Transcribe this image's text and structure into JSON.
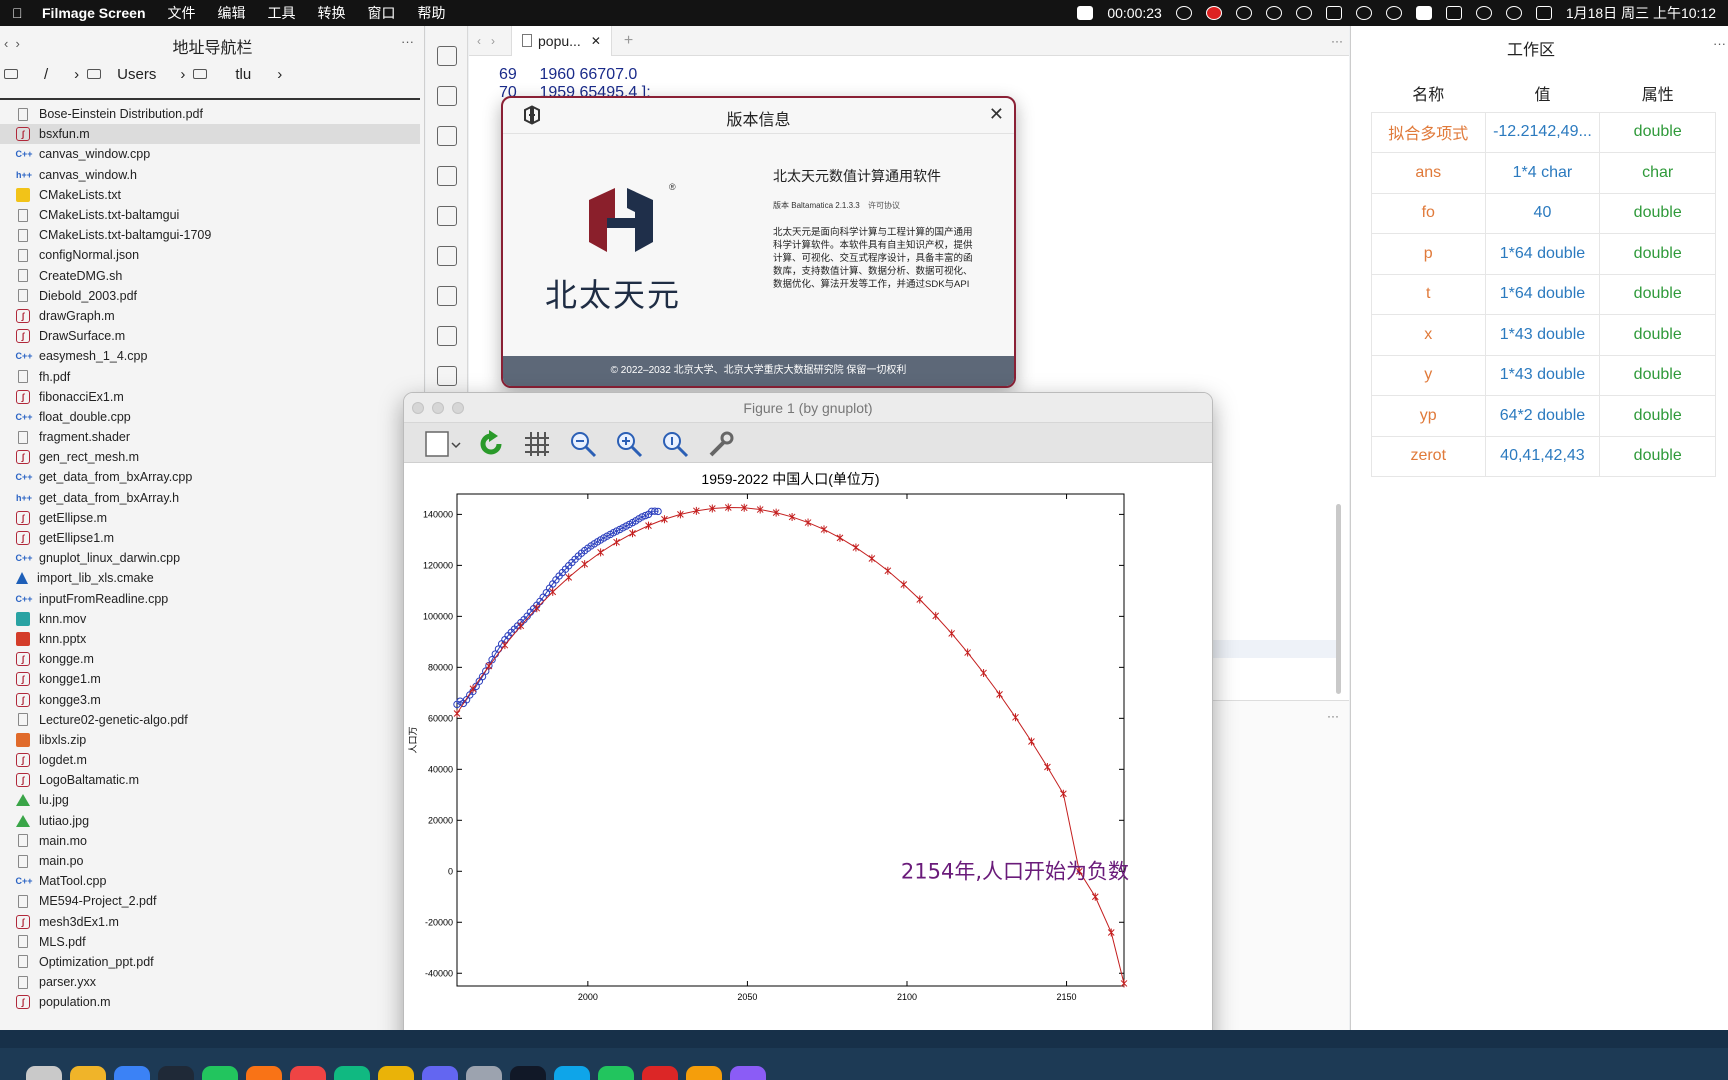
{
  "menubar": {
    "app_name": "Filmage Screen",
    "menus": [
      "文件",
      "编辑",
      "工具",
      "转换",
      "窗口",
      "帮助"
    ],
    "timer": "00:00:23",
    "datetime": "1月18日 周三 上午10:12"
  },
  "filepanel": {
    "title": "地址导航栏",
    "crumbs": [
      "/",
      "Users",
      "tlu"
    ],
    "files": [
      {
        "name": "Bose-Einstein Distribution.pdf",
        "type": "doc"
      },
      {
        "name": "bsxfun.m",
        "type": "m",
        "selected": true
      },
      {
        "name": "canvas_window.cpp",
        "type": "cpp"
      },
      {
        "name": "canvas_window.h",
        "type": "h"
      },
      {
        "name": "CMakeLists.txt",
        "type": "txt"
      },
      {
        "name": "CMakeLists.txt-baltamgui",
        "type": "doc"
      },
      {
        "name": "CMakeLists.txt-baltamgui-1709",
        "type": "doc"
      },
      {
        "name": "configNormal.json",
        "type": "doc"
      },
      {
        "name": "CreateDMG.sh",
        "type": "doc"
      },
      {
        "name": "Diebold_2003.pdf",
        "type": "doc"
      },
      {
        "name": "drawGraph.m",
        "type": "m"
      },
      {
        "name": "DrawSurface.m",
        "type": "m"
      },
      {
        "name": "easymesh_1_4.cpp",
        "type": "cpp"
      },
      {
        "name": "fh.pdf",
        "type": "doc"
      },
      {
        "name": "fibonacciEx1.m",
        "type": "m"
      },
      {
        "name": "float_double.cpp",
        "type": "cpp"
      },
      {
        "name": "fragment.shader",
        "type": "doc"
      },
      {
        "name": "gen_rect_mesh.m",
        "type": "m"
      },
      {
        "name": "get_data_from_bxArray.cpp",
        "type": "cpp"
      },
      {
        "name": "get_data_from_bxArray.h",
        "type": "h"
      },
      {
        "name": "getEllipse.m",
        "type": "m"
      },
      {
        "name": "getEllipse1.m",
        "type": "m"
      },
      {
        "name": "gnuplot_linux_darwin.cpp",
        "type": "cpp"
      },
      {
        "name": "import_lib_xls.cmake",
        "type": "cmake"
      },
      {
        "name": "inputFromReadline.cpp",
        "type": "cpp"
      },
      {
        "name": "knn.mov",
        "type": "mov"
      },
      {
        "name": "knn.pptx",
        "type": "pptx"
      },
      {
        "name": "kongge.m",
        "type": "m"
      },
      {
        "name": "kongge1.m",
        "type": "m"
      },
      {
        "name": "kongge3.m",
        "type": "m"
      },
      {
        "name": "Lecture02-genetic-algo.pdf",
        "type": "doc"
      },
      {
        "name": "libxls.zip",
        "type": "zip"
      },
      {
        "name": "logdet.m",
        "type": "m"
      },
      {
        "name": "LogoBaltamatic.m",
        "type": "m"
      },
      {
        "name": "lu.jpg",
        "type": "img"
      },
      {
        "name": "lutiao.jpg",
        "type": "img"
      },
      {
        "name": "main.mo",
        "type": "doc"
      },
      {
        "name": "main.po",
        "type": "doc"
      },
      {
        "name": "MatTool.cpp",
        "type": "cpp"
      },
      {
        "name": "ME594-Project_2.pdf",
        "type": "doc"
      },
      {
        "name": "mesh3dEx1.m",
        "type": "m"
      },
      {
        "name": "MLS.pdf",
        "type": "doc"
      },
      {
        "name": "Optimization_ppt.pdf",
        "type": "doc"
      },
      {
        "name": "parser.yxx",
        "type": "doc"
      },
      {
        "name": "population.m",
        "type": "m"
      }
    ]
  },
  "editor": {
    "tab_label": "popu...",
    "lines": [
      {
        "num": "69",
        "text": "1960 66707.0"
      },
      {
        "num": "70",
        "text": "1959 65495.4 ];"
      }
    ]
  },
  "workspace": {
    "title": "工作区",
    "headers": [
      "名称",
      "值",
      "属性"
    ],
    "rows": [
      {
        "name": "拟合多项式",
        "value": "-12.2142,49...",
        "attr": "double"
      },
      {
        "name": "ans",
        "value": "1*4 char",
        "attr": "char"
      },
      {
        "name": "fo",
        "value": "40",
        "attr": "double"
      },
      {
        "name": "p",
        "value": "1*64 double",
        "attr": "double"
      },
      {
        "name": "t",
        "value": "1*64 double",
        "attr": "double"
      },
      {
        "name": "x",
        "value": "1*43 double",
        "attr": "double"
      },
      {
        "name": "y",
        "value": "1*43 double",
        "attr": "double"
      },
      {
        "name": "yp",
        "value": "64*2 double",
        "attr": "double"
      },
      {
        "name": "zerot",
        "value": "40,41,42,43",
        "attr": "double"
      }
    ]
  },
  "version_dialog": {
    "title": "版本信息",
    "logo_text": "北太天元",
    "product": "北太天元数值计算通用软件",
    "version_prefix": "版本",
    "version": "Baltamatica 2.1.3.3",
    "license": "许可协议",
    "description": "北太天元是面向科学计算与工程计算的国产通用科学计算软件。本软件具有自主知识产权，提供计算、可视化、交互式程序设计，具备丰富的函数库，支持数值计算、数据分析、数据可视化、数据优化、算法开发等工作，并通过SDK与API",
    "footer": "©  2022–2032  北京大学、北京大学重庆大数据研究院 保留一切权利"
  },
  "figure": {
    "window_title": "Figure 1 (by gnuplot)"
  },
  "chart_data": {
    "type": "line",
    "title": "1959-2022 中国人口(单位万)",
    "xlabel": "",
    "ylabel": "人口万",
    "xlim": [
      1959,
      2168
    ],
    "ylim": [
      -45000,
      148000
    ],
    "xticks": [
      2000,
      2050,
      2100,
      2150
    ],
    "yticks": [
      -40000,
      -20000,
      0,
      20000,
      40000,
      60000,
      80000,
      100000,
      120000,
      140000
    ],
    "annotation": "2154年,人口开始为负数",
    "grid": false,
    "series": [
      {
        "marker": "circle",
        "color": "#2b3fbd",
        "x": [
          1959,
          1960,
          1961,
          1962,
          1963,
          1964,
          1965,
          1966,
          1967,
          1968,
          1969,
          1970,
          1971,
          1972,
          1973,
          1974,
          1975,
          1976,
          1977,
          1978,
          1979,
          1980,
          1981,
          1982,
          1983,
          1984,
          1985,
          1986,
          1987,
          1988,
          1989,
          1990,
          1991,
          1992,
          1993,
          1994,
          1995,
          1996,
          1997,
          1998,
          1999,
          2000,
          2001,
          2002,
          2003,
          2004,
          2005,
          2006,
          2007,
          2008,
          2009,
          2010,
          2011,
          2012,
          2013,
          2014,
          2015,
          2016,
          2017,
          2018,
          2019,
          2020,
          2021,
          2022
        ],
        "y": [
          65495,
          66707,
          65859,
          67296,
          69172,
          70499,
          72538,
          74542,
          76368,
          78534,
          80671,
          82992,
          85229,
          87177,
          89211,
          90859,
          92420,
          93717,
          94974,
          96259,
          97542,
          98705,
          100072,
          101654,
          103008,
          104357,
          105851,
          107507,
          109300,
          111026,
          112704,
          114333,
          115823,
          117171,
          118517,
          119850,
          121121,
          122389,
          123626,
          124761,
          125786,
          126743,
          127627,
          128453,
          129227,
          129988,
          130756,
          131448,
          132129,
          132802,
          133450,
          134091,
          134735,
          135404,
          136072,
          136782,
          137462,
          138271,
          139008,
          139538,
          140005,
          141212,
          141260,
          141175
        ]
      },
      {
        "marker": "asterisk",
        "color": "#c41f1f",
        "x": [
          1959,
          1964,
          1969,
          1974,
          1979,
          1984,
          1989,
          1994,
          1999,
          2004,
          2009,
          2014,
          2019,
          2024,
          2029,
          2034,
          2039,
          2044,
          2049,
          2054,
          2059,
          2064,
          2069,
          2074,
          2079,
          2084,
          2089,
          2094,
          2099,
          2104,
          2109,
          2114,
          2119,
          2124,
          2129,
          2134,
          2139,
          2144,
          2149,
          2154,
          2159,
          2164,
          2168
        ],
        "y": [
          61900,
          71600,
          80500,
          88700,
          96300,
          103200,
          109600,
          115300,
          120500,
          125100,
          129100,
          132600,
          135600,
          138100,
          140000,
          141400,
          142300,
          142700,
          142600,
          141900,
          140700,
          139000,
          136800,
          134100,
          130800,
          127000,
          122700,
          117900,
          112500,
          106600,
          100200,
          93300,
          85800,
          77800,
          69400,
          60400,
          50900,
          40900,
          30400,
          0,
          -10000,
          -24000,
          -44000
        ]
      }
    ]
  }
}
